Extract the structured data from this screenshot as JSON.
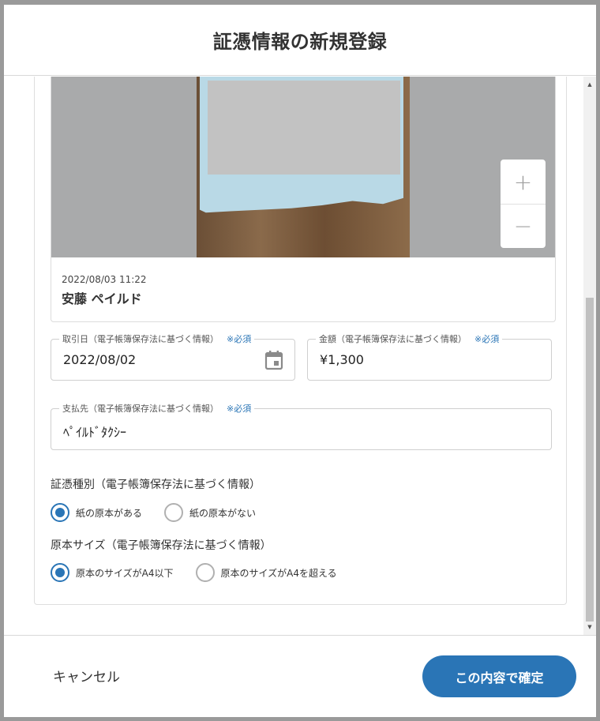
{
  "dialog": {
    "title": "証憑情報の新規登録"
  },
  "receipt": {
    "datetime": "2022/08/03 11:22",
    "uploader": "安藤 ペイルド",
    "zoom_in": "+",
    "zoom_out": "−"
  },
  "fields": {
    "transaction_date": {
      "label": "取引日（電子帳簿保存法に基づく情報）",
      "required": "※必須",
      "value": "2022/08/02"
    },
    "amount": {
      "label": "金額（電子帳簿保存法に基づく情報）",
      "required": "※必須",
      "value": "¥1,300"
    },
    "payee": {
      "label": "支払先（電子帳簿保存法に基づく情報）",
      "required": "※必須",
      "value": "ﾍﾟｲﾙﾄﾞﾀｸｼｰ"
    }
  },
  "document_type": {
    "label": "証憑種別（電子帳簿保存法に基づく情報）",
    "options": [
      "紙の原本がある",
      "紙の原本がない"
    ],
    "selected": "紙の原本がある"
  },
  "original_size": {
    "label": "原本サイズ（電子帳簿保存法に基づく情報）",
    "options": [
      "原本のサイズがA4以下",
      "原本のサイズがA4を超える"
    ],
    "selected": "原本のサイズがA4以下"
  },
  "footer": {
    "cancel_label": "キャンセル",
    "confirm_label": "この内容で確定"
  },
  "colors": {
    "accent": "#2a75b6",
    "required": "#2a75b6",
    "preview_background": "#a9aaab",
    "receipt_paper": "#b9d9e6"
  },
  "icons": {
    "date_picker": "calendar-icon",
    "zoom_in": "plus-icon",
    "zoom_out": "minus-icon"
  }
}
